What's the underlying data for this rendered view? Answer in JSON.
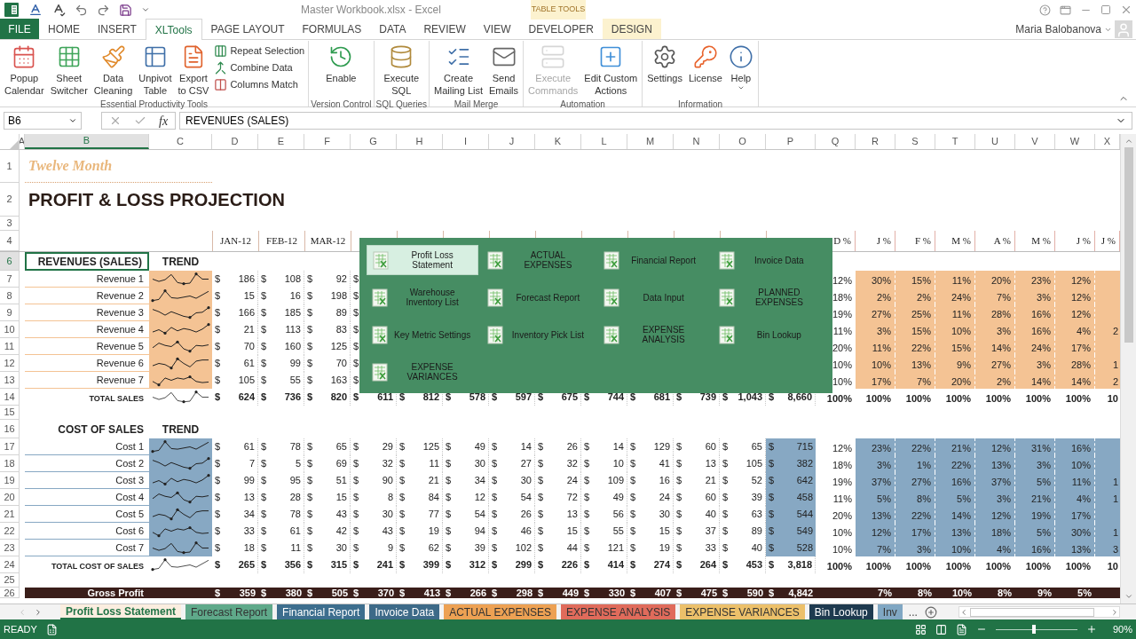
{
  "title_bar": {
    "title": "Master Workbook.xlsx - Excel",
    "context": "TABLE TOOLS"
  },
  "ribbon_tabs": [
    {
      "label": "FILE",
      "kind": "file",
      "selected": false
    },
    {
      "label": "HOME",
      "kind": "tab",
      "selected": false
    },
    {
      "label": "INSERT",
      "kind": "tab",
      "selected": false
    },
    {
      "label": "XLTools",
      "kind": "tab",
      "selected": true
    },
    {
      "label": "PAGE LAYOUT",
      "kind": "tab",
      "selected": false
    },
    {
      "label": "FORMULAS",
      "kind": "tab",
      "selected": false
    },
    {
      "label": "DATA",
      "kind": "tab",
      "selected": false
    },
    {
      "label": "REVIEW",
      "kind": "tab",
      "selected": false
    },
    {
      "label": "VIEW",
      "kind": "tab",
      "selected": false
    },
    {
      "label": "DEVELOPER",
      "kind": "tab",
      "selected": false
    },
    {
      "label": "DESIGN",
      "kind": "context",
      "selected": false
    }
  ],
  "user": "Maria Balobanova",
  "ribbon_groups": [
    {
      "label": "Essential Productivity Tools",
      "buttons": [
        {
          "kind": "large",
          "label": "Popup\nCalendar",
          "disabled": false,
          "dropdown": false
        },
        {
          "kind": "large",
          "label": "Sheet\nSwitcher",
          "disabled": false,
          "dropdown": false
        },
        {
          "kind": "large",
          "label": "Data\nCleaning",
          "disabled": false,
          "dropdown": false
        },
        {
          "kind": "large",
          "label": "Unpivot\nTable",
          "disabled": false,
          "dropdown": false
        },
        {
          "kind": "large",
          "label": "Export\nto CSV",
          "disabled": false,
          "dropdown": false
        },
        {
          "kind": "small",
          "label": "Repeat Selection",
          "disabled": false,
          "dropdown": false
        },
        {
          "kind": "small",
          "label": "Combine Data",
          "disabled": false,
          "dropdown": false
        },
        {
          "kind": "small",
          "label": "Columns Match",
          "disabled": false,
          "dropdown": false
        }
      ]
    },
    {
      "label": "Version Control",
      "buttons": [
        {
          "kind": "large",
          "label": "Enable",
          "disabled": false,
          "dropdown": false
        }
      ]
    },
    {
      "label": "SQL Queries",
      "buttons": [
        {
          "kind": "large",
          "label": "Execute\nSQL",
          "disabled": false,
          "dropdown": false
        }
      ]
    },
    {
      "label": "Mail Merge",
      "buttons": [
        {
          "kind": "large",
          "label": "Create\nMailing List",
          "disabled": false,
          "dropdown": false
        },
        {
          "kind": "large",
          "label": "Send\nEmails",
          "disabled": false,
          "dropdown": false
        }
      ]
    },
    {
      "label": "Automation",
      "buttons": [
        {
          "kind": "large",
          "label": "Execute\nCommands",
          "disabled": true,
          "dropdown": false
        },
        {
          "kind": "large",
          "label": "Edit Custom\nActions",
          "disabled": false,
          "dropdown": false
        }
      ]
    },
    {
      "label": "Information",
      "buttons": [
        {
          "kind": "large",
          "label": "Settings",
          "disabled": false,
          "dropdown": false
        },
        {
          "kind": "large",
          "label": "License",
          "disabled": false,
          "dropdown": false
        },
        {
          "kind": "large",
          "label": "Help",
          "disabled": false,
          "dropdown": true
        }
      ]
    }
  ],
  "formula_bar": {
    "name_box": "B6",
    "fx": "fx",
    "content": "REVENUES (SALES)"
  },
  "columns": [
    {
      "label": "A",
      "selected": false
    },
    {
      "label": "B",
      "selected": true
    },
    {
      "label": "C",
      "selected": false
    },
    {
      "label": "D",
      "selected": false
    },
    {
      "label": "E",
      "selected": false
    },
    {
      "label": "F",
      "selected": false
    },
    {
      "label": "G",
      "selected": false
    },
    {
      "label": "H",
      "selected": false
    },
    {
      "label": "I",
      "selected": false
    },
    {
      "label": "J",
      "selected": false
    },
    {
      "label": "K",
      "selected": false
    },
    {
      "label": "L",
      "selected": false
    },
    {
      "label": "M",
      "selected": false
    },
    {
      "label": "N",
      "selected": false
    },
    {
      "label": "O",
      "selected": false
    },
    {
      "label": "P",
      "selected": false
    },
    {
      "label": "Q",
      "selected": false
    },
    {
      "label": "R",
      "selected": false
    },
    {
      "label": "S",
      "selected": false
    },
    {
      "label": "T",
      "selected": false
    },
    {
      "label": "U",
      "selected": false
    },
    {
      "label": "V",
      "selected": false
    },
    {
      "label": "W",
      "selected": false
    },
    {
      "label": "X",
      "selected": false
    }
  ],
  "rows": [
    {
      "num": "1",
      "kind": "subtitle",
      "text": "Twelve Month",
      "selected": false
    },
    {
      "num": "2",
      "kind": "title",
      "text": "PROFIT & LOSS PROJECTION",
      "selected": false
    },
    {
      "num": "3",
      "kind": "blank",
      "selected": false
    },
    {
      "num": "4",
      "kind": "months",
      "months": [
        "JAN-12",
        "FEB-12",
        "MAR-12"
      ],
      "pct_headers": [
        "D %",
        "J %",
        "F %",
        "M %",
        "A %",
        "M %",
        "J %",
        "J %"
      ],
      "selected": false
    },
    {
      "num": "6",
      "kind": "section",
      "label": "REVENUES (SALES)",
      "trend": "TREND",
      "active": true,
      "selected": true
    },
    {
      "num": "7",
      "kind": "data",
      "color": "#f4c394",
      "label": "Revenue 1",
      "cells": [
        [
          "$",
          "186"
        ],
        [
          "$",
          "108"
        ],
        [
          "$",
          "92"
        ],
        [
          "$"
        ]
      ],
      "share": "12%",
      "pct": [
        "30%",
        "15%",
        "11%",
        "20%",
        "23%",
        "12%"
      ],
      "selected": false
    },
    {
      "num": "8",
      "kind": "data",
      "color": "#f4c394",
      "label": "Revenue 2",
      "cells": [
        [
          "$",
          "15"
        ],
        [
          "$",
          "16"
        ],
        [
          "$",
          "198"
        ],
        [
          "$"
        ]
      ],
      "share": "18%",
      "pct": [
        "2%",
        "2%",
        "24%",
        "7%",
        "3%",
        "12%"
      ],
      "selected": false
    },
    {
      "num": "9",
      "kind": "data",
      "color": "#f4c394",
      "label": "Revenue 3",
      "cells": [
        [
          "$",
          "166"
        ],
        [
          "$",
          "185"
        ],
        [
          "$",
          "89"
        ],
        [
          "$"
        ]
      ],
      "share": "19%",
      "pct": [
        "27%",
        "25%",
        "11%",
        "28%",
        "16%",
        "12%"
      ],
      "selected": false
    },
    {
      "num": "10",
      "kind": "data",
      "color": "#f4c394",
      "label": "Revenue 4",
      "cells": [
        [
          "$",
          "21"
        ],
        [
          "$",
          "113"
        ],
        [
          "$",
          "83"
        ],
        [
          "$"
        ]
      ],
      "share": "11%",
      "pct": [
        "3%",
        "15%",
        "10%",
        "3%",
        "16%",
        "4%"
      ],
      "edge": "2",
      "selected": false
    },
    {
      "num": "11",
      "kind": "data",
      "color": "#f4c394",
      "label": "Revenue 5",
      "cells": [
        [
          "$",
          "70"
        ],
        [
          "$",
          "160"
        ],
        [
          "$",
          "125"
        ],
        [
          "$"
        ]
      ],
      "share": "20%",
      "pct": [
        "11%",
        "22%",
        "15%",
        "14%",
        "24%",
        "17%"
      ],
      "selected": false
    },
    {
      "num": "12",
      "kind": "data",
      "color": "#f4c394",
      "label": "Revenue 6",
      "cells": [
        [
          "$",
          "61"
        ],
        [
          "$",
          "99"
        ],
        [
          "$",
          "70"
        ],
        [
          "$"
        ]
      ],
      "share": "10%",
      "pct": [
        "10%",
        "13%",
        "9%",
        "27%",
        "3%",
        "28%"
      ],
      "edge": "1",
      "selected": false
    },
    {
      "num": "13",
      "kind": "data",
      "color": "#f4c394",
      "label": "Revenue 7",
      "cells": [
        [
          "$",
          "105"
        ],
        [
          "$",
          "55"
        ],
        [
          "$",
          "163"
        ],
        [
          "$"
        ]
      ],
      "share": "10%",
      "pct": [
        "17%",
        "7%",
        "20%",
        "2%",
        "14%",
        "14%"
      ],
      "edge": "2",
      "selected": false
    },
    {
      "num": "14",
      "kind": "total",
      "label": "TOTAL SALES",
      "cells": [
        [
          "$",
          "624"
        ],
        [
          "$",
          "736"
        ],
        [
          "$",
          "820"
        ],
        [
          "$",
          "611"
        ],
        [
          "$",
          "812"
        ],
        [
          "$",
          "578"
        ],
        [
          "$",
          "597"
        ],
        [
          "$",
          "675"
        ],
        [
          "$",
          "744"
        ],
        [
          "$",
          "681"
        ],
        [
          "$",
          "739"
        ],
        [
          "$",
          "1,043"
        ],
        [
          "$",
          "8,660"
        ]
      ],
      "share": "100%",
      "pct": [
        "100%",
        "100%",
        "100%",
        "100%",
        "100%",
        "100%"
      ],
      "edge": "10",
      "selected": false
    },
    {
      "num": "15",
      "kind": "blank",
      "selected": false
    },
    {
      "num": "16",
      "kind": "section",
      "label": "COST OF SALES",
      "trend": "TREND",
      "active": false,
      "selected": false
    },
    {
      "num": "17",
      "kind": "data",
      "color": "#87a8c3",
      "label": "Cost 1",
      "cells": [
        [
          "$",
          "61"
        ],
        [
          "$",
          "78"
        ],
        [
          "$",
          "65"
        ],
        [
          "$",
          "29"
        ],
        [
          "$",
          "125"
        ],
        [
          "$",
          "49"
        ],
        [
          "$",
          "14"
        ],
        [
          "$",
          "26"
        ],
        [
          "$",
          "14"
        ],
        [
          "$",
          "129"
        ],
        [
          "$",
          "60"
        ],
        [
          "$",
          "65"
        ],
        [
          "$",
          "715"
        ]
      ],
      "share": "12%",
      "pct": [
        "23%",
        "22%",
        "21%",
        "12%",
        "31%",
        "16%"
      ],
      "selected": false
    },
    {
      "num": "18",
      "kind": "data",
      "color": "#87a8c3",
      "label": "Cost 2",
      "cells": [
        [
          "$",
          "7"
        ],
        [
          "$",
          "5"
        ],
        [
          "$",
          "69"
        ],
        [
          "$",
          "32"
        ],
        [
          "$",
          "11"
        ],
        [
          "$",
          "30"
        ],
        [
          "$",
          "27"
        ],
        [
          "$",
          "32"
        ],
        [
          "$",
          "10"
        ],
        [
          "$",
          "41"
        ],
        [
          "$",
          "13"
        ],
        [
          "$",
          "105"
        ],
        [
          "$",
          "382"
        ]
      ],
      "share": "18%",
      "pct": [
        "3%",
        "1%",
        "22%",
        "13%",
        "3%",
        "10%"
      ],
      "selected": false
    },
    {
      "num": "19",
      "kind": "data",
      "color": "#87a8c3",
      "label": "Cost 3",
      "cells": [
        [
          "$",
          "99"
        ],
        [
          "$",
          "95"
        ],
        [
          "$",
          "51"
        ],
        [
          "$",
          "90"
        ],
        [
          "$",
          "21"
        ],
        [
          "$",
          "34"
        ],
        [
          "$",
          "30"
        ],
        [
          "$",
          "24"
        ],
        [
          "$",
          "109"
        ],
        [
          "$",
          "16"
        ],
        [
          "$",
          "21"
        ],
        [
          "$",
          "52"
        ],
        [
          "$",
          "642"
        ]
      ],
      "share": "19%",
      "pct": [
        "37%",
        "27%",
        "16%",
        "37%",
        "5%",
        "11%"
      ],
      "edge": "1",
      "selected": false
    },
    {
      "num": "20",
      "kind": "data",
      "color": "#87a8c3",
      "label": "Cost 4",
      "cells": [
        [
          "$",
          "13"
        ],
        [
          "$",
          "28"
        ],
        [
          "$",
          "15"
        ],
        [
          "$",
          "8"
        ],
        [
          "$",
          "84"
        ],
        [
          "$",
          "12"
        ],
        [
          "$",
          "54"
        ],
        [
          "$",
          "72"
        ],
        [
          "$",
          "49"
        ],
        [
          "$",
          "24"
        ],
        [
          "$",
          "60"
        ],
        [
          "$",
          "39"
        ],
        [
          "$",
          "458"
        ]
      ],
      "share": "11%",
      "pct": [
        "5%",
        "8%",
        "5%",
        "3%",
        "21%",
        "4%"
      ],
      "edge": "1",
      "selected": false
    },
    {
      "num": "21",
      "kind": "data",
      "color": "#87a8c3",
      "label": "Cost 5",
      "cells": [
        [
          "$",
          "34"
        ],
        [
          "$",
          "78"
        ],
        [
          "$",
          "43"
        ],
        [
          "$",
          "30"
        ],
        [
          "$",
          "77"
        ],
        [
          "$",
          "54"
        ],
        [
          "$",
          "26"
        ],
        [
          "$",
          "13"
        ],
        [
          "$",
          "56"
        ],
        [
          "$",
          "30"
        ],
        [
          "$",
          "40"
        ],
        [
          "$",
          "63"
        ],
        [
          "$",
          "544"
        ]
      ],
      "share": "20%",
      "pct": [
        "13%",
        "22%",
        "14%",
        "12%",
        "19%",
        "17%"
      ],
      "selected": false
    },
    {
      "num": "22",
      "kind": "data",
      "color": "#87a8c3",
      "label": "Cost 6",
      "cells": [
        [
          "$",
          "33"
        ],
        [
          "$",
          "61"
        ],
        [
          "$",
          "42"
        ],
        [
          "$",
          "43"
        ],
        [
          "$",
          "19"
        ],
        [
          "$",
          "94"
        ],
        [
          "$",
          "46"
        ],
        [
          "$",
          "15"
        ],
        [
          "$",
          "55"
        ],
        [
          "$",
          "15"
        ],
        [
          "$",
          "37"
        ],
        [
          "$",
          "89"
        ],
        [
          "$",
          "549"
        ]
      ],
      "share": "10%",
      "pct": [
        "12%",
        "17%",
        "13%",
        "18%",
        "5%",
        "30%"
      ],
      "edge": "1",
      "selected": false
    },
    {
      "num": "23",
      "kind": "data",
      "color": "#87a8c3",
      "label": "Cost 7",
      "cells": [
        [
          "$",
          "18"
        ],
        [
          "$",
          "11"
        ],
        [
          "$",
          "30"
        ],
        [
          "$",
          "9"
        ],
        [
          "$",
          "62"
        ],
        [
          "$",
          "39"
        ],
        [
          "$",
          "102"
        ],
        [
          "$",
          "44"
        ],
        [
          "$",
          "121"
        ],
        [
          "$",
          "19"
        ],
        [
          "$",
          "33"
        ],
        [
          "$",
          "40"
        ],
        [
          "$",
          "528"
        ]
      ],
      "share": "10%",
      "pct": [
        "7%",
        "3%",
        "10%",
        "4%",
        "16%",
        "13%"
      ],
      "edge": "3",
      "selected": false
    },
    {
      "num": "24",
      "kind": "total",
      "label": "TOTAL COST OF SALES",
      "cells": [
        [
          "$",
          "265"
        ],
        [
          "$",
          "356"
        ],
        [
          "$",
          "315"
        ],
        [
          "$",
          "241"
        ],
        [
          "$",
          "399"
        ],
        [
          "$",
          "312"
        ],
        [
          "$",
          "299"
        ],
        [
          "$",
          "226"
        ],
        [
          "$",
          "414"
        ],
        [
          "$",
          "274"
        ],
        [
          "$",
          "264"
        ],
        [
          "$",
          "453"
        ],
        [
          "$",
          "3,818"
        ]
      ],
      "share": "100%",
      "pct": [
        "100%",
        "100%",
        "100%",
        "100%",
        "100%",
        "100%"
      ],
      "edge": "10",
      "selected": false
    },
    {
      "num": "25",
      "kind": "blank",
      "selected": false
    },
    {
      "num": "26",
      "kind": "band",
      "label": "Gross Profit",
      "cells": [
        [
          "$",
          "359"
        ],
        [
          "$",
          "380"
        ],
        [
          "$",
          "505"
        ],
        [
          "$",
          "370"
        ],
        [
          "$",
          "413"
        ],
        [
          "$",
          "266"
        ],
        [
          "$",
          "298"
        ],
        [
          "$",
          "449"
        ],
        [
          "$",
          "330"
        ],
        [
          "$",
          "407"
        ],
        [
          "$",
          "475"
        ],
        [
          "$",
          "590"
        ],
        [
          "$",
          "4,842"
        ]
      ],
      "pct": [
        "7%",
        "8%",
        "10%",
        "8%",
        "9%",
        "5%"
      ],
      "selected": false
    }
  ],
  "sheet_switcher": {
    "items": [
      {
        "label": "Profit Loss\nStatement",
        "selected": true
      },
      {
        "label": "ACTUAL\nEXPENSES",
        "selected": false
      },
      {
        "label": "Financial Report",
        "selected": false
      },
      {
        "label": "Invoice Data",
        "selected": false
      },
      {
        "label": "Warehouse\nInventory List",
        "selected": false
      },
      {
        "label": "Forecast Report",
        "selected": false
      },
      {
        "label": "Data Input",
        "selected": false
      },
      {
        "label": "PLANNED\nEXPENSES",
        "selected": false
      },
      {
        "label": "Key Metric Settings",
        "selected": false
      },
      {
        "label": "Inventory Pick List",
        "selected": false
      },
      {
        "label": "EXPENSE\nANALYSIS",
        "selected": false
      },
      {
        "label": "Bin Lookup",
        "selected": false
      },
      {
        "label": "EXPENSE\nVARIANCES",
        "selected": false
      }
    ]
  },
  "sheet_tabs": {
    "more": "...",
    "tabs": [
      {
        "label": "Profit Loss Statement",
        "color": "#fbeee0",
        "selected": true
      },
      {
        "label": "Forecast Report",
        "color": "#5fa98a",
        "selected": false
      },
      {
        "label": "Financial Report",
        "color": "#3d6e8e",
        "selected": false
      },
      {
        "label": "Invoice Data",
        "color": "#3d6a88",
        "selected": false
      },
      {
        "label": "ACTUAL EXPENSES",
        "color": "#eda153",
        "selected": false
      },
      {
        "label": "EXPENSE ANALYSIS",
        "color": "#e06b5b",
        "selected": false
      },
      {
        "label": "EXPENSE VARIANCES",
        "color": "#ecc06a",
        "selected": false
      },
      {
        "label": "Bin Lookup",
        "color": "#1e3a4f",
        "selected": false
      },
      {
        "label": "Inv",
        "color": "#80a7c3",
        "selected": false
      }
    ]
  },
  "status_bar": {
    "status": "READY",
    "zoom": {
      "reading": "90%",
      "level": 0.47
    }
  }
}
